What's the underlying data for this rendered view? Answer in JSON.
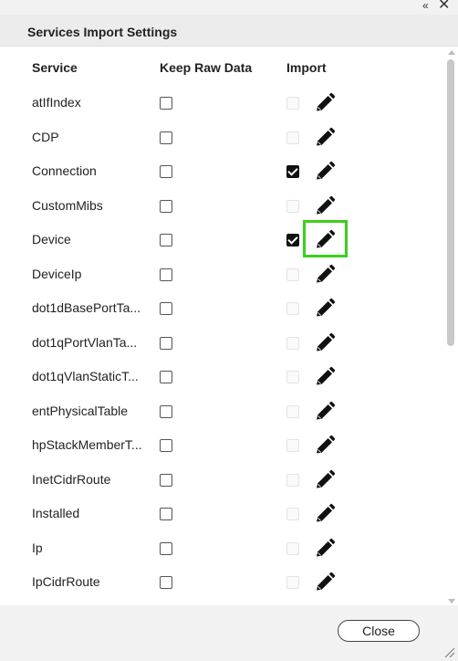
{
  "window": {
    "collapse_glyph": "«",
    "close_glyph": "✕"
  },
  "header": {
    "title": "Services Import Settings"
  },
  "columns": {
    "service": "Service",
    "keep_raw": "Keep Raw Data",
    "import": "Import"
  },
  "rows": [
    {
      "name": "atIfIndex",
      "keep_raw": false,
      "import": false,
      "import_enabled": false
    },
    {
      "name": "CDP",
      "keep_raw": false,
      "import": false,
      "import_enabled": false
    },
    {
      "name": "Connection",
      "keep_raw": false,
      "import": true,
      "import_enabled": true
    },
    {
      "name": "CustomMibs",
      "keep_raw": false,
      "import": false,
      "import_enabled": false
    },
    {
      "name": "Device",
      "keep_raw": false,
      "import": true,
      "import_enabled": true
    },
    {
      "name": "DeviceIp",
      "keep_raw": false,
      "import": false,
      "import_enabled": false
    },
    {
      "name": "dot1dBasePortTa...",
      "keep_raw": false,
      "import": false,
      "import_enabled": false
    },
    {
      "name": "dot1qPortVlanTa...",
      "keep_raw": false,
      "import": false,
      "import_enabled": false
    },
    {
      "name": "dot1qVlanStaticT...",
      "keep_raw": false,
      "import": false,
      "import_enabled": false
    },
    {
      "name": "entPhysicalTable",
      "keep_raw": false,
      "import": false,
      "import_enabled": false
    },
    {
      "name": "hpStackMemberT...",
      "keep_raw": false,
      "import": false,
      "import_enabled": false
    },
    {
      "name": "InetCidrRoute",
      "keep_raw": false,
      "import": false,
      "import_enabled": false
    },
    {
      "name": "Installed",
      "keep_raw": false,
      "import": false,
      "import_enabled": false
    },
    {
      "name": "Ip",
      "keep_raw": false,
      "import": false,
      "import_enabled": false
    },
    {
      "name": "IpCidrRoute",
      "keep_raw": false,
      "import": false,
      "import_enabled": false
    }
  ],
  "row_icon": "pencil-edit-icon",
  "highlight_row": "Device",
  "highlight_color": "#3ccf1c",
  "footer": {
    "close_label": "Close"
  }
}
